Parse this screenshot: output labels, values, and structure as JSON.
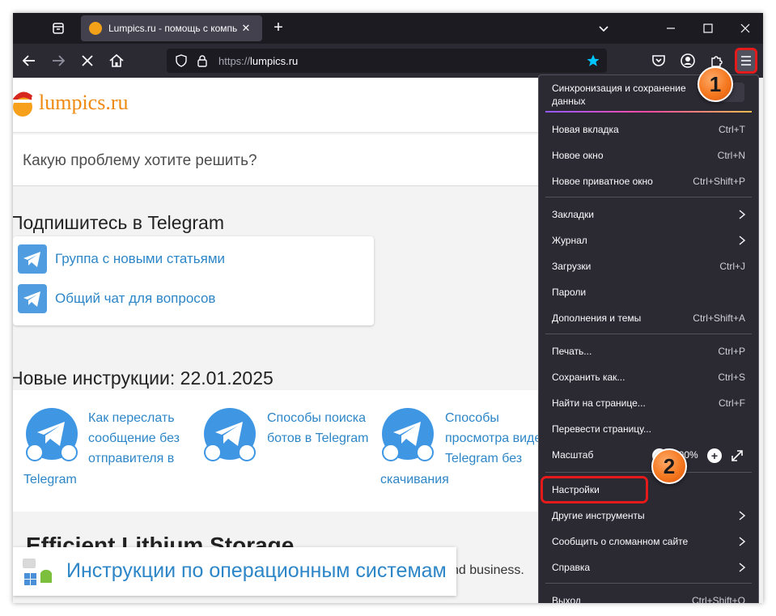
{
  "browser": {
    "tab": {
      "title": "Lumpics.ru - помощь с компь"
    },
    "url": {
      "protocol": "https://",
      "host": "lumpics.ru"
    },
    "icons": {
      "tab_list": "tab-list-icon",
      "close": "close-icon",
      "new_tab": "plus-icon",
      "back": "back-arrow-icon",
      "forward": "forward-arrow-icon",
      "stop": "stop-icon",
      "home": "home-icon",
      "shield": "shield-icon",
      "lock": "lock-icon",
      "bookmark": "star-icon",
      "pocket": "pocket-icon",
      "account": "account-icon",
      "extensions": "puzzle-icon",
      "menu": "hamburger-icon"
    }
  },
  "page": {
    "logo": "lumpics.ru",
    "search_placeholder": "Какую проблему хотите решить?",
    "telegram_heading": "Подпишитесь в Telegram",
    "telegram_links": [
      "Группа с новыми статьями",
      "Общий чат для вопросов"
    ],
    "new_heading": "Новые инструкции: 22.01.2025",
    "articles": [
      {
        "lines": [
          "Как переслать",
          "сообщение без",
          "отправителя в"
        ],
        "tail": "Telegram"
      },
      {
        "lines": [
          "Способы поиска",
          "ботов в Telegram"
        ],
        "tail": ""
      },
      {
        "lines": [
          "Способы",
          "просмотра виде",
          "Telegram без"
        ],
        "tail": "скачивания"
      }
    ],
    "ad_title": "Efficient Lithium Storage",
    "ad_tail": "nd business.",
    "os_banner": "Инструкции по операционным системам"
  },
  "menu": {
    "sync": "Синхронизация и сохранение данных",
    "items": [
      {
        "label": "Новая вкладка",
        "shortcut": "Ctrl+T"
      },
      {
        "label": "Новое окно",
        "shortcut": "Ctrl+N"
      },
      {
        "label": "Новое приватное окно",
        "shortcut": "Ctrl+Shift+P"
      },
      {
        "label": "Закладки",
        "shortcut": ""
      },
      {
        "label": "Журнал",
        "shortcut": ""
      },
      {
        "label": "Загрузки",
        "shortcut": "Ctrl+J"
      },
      {
        "label": "Пароли",
        "shortcut": ""
      },
      {
        "label": "Дополнения и темы",
        "shortcut": "Ctrl+Shift+A"
      },
      {
        "label": "Печать...",
        "shortcut": "Ctrl+P"
      },
      {
        "label": "Сохранить как...",
        "shortcut": "Ctrl+S"
      },
      {
        "label": "Найти на странице...",
        "shortcut": "Ctrl+F"
      },
      {
        "label": "Перевести страницу...",
        "shortcut": ""
      },
      {
        "label": "Масштаб",
        "shortcut": ""
      },
      {
        "label": "Настройки",
        "shortcut": ""
      },
      {
        "label": "Другие инструменты",
        "shortcut": ""
      },
      {
        "label": "Сообщить о сломанном сайте",
        "shortcut": ""
      },
      {
        "label": "Справка",
        "shortcut": ""
      },
      {
        "label": "Выход",
        "shortcut": "Ctrl+Shift+Q"
      }
    ],
    "zoom": {
      "minus": "−",
      "value": "100%",
      "plus": "+"
    }
  },
  "callouts": {
    "first": "1",
    "second": "2"
  },
  "colors": {
    "accent_red": "#e51a1a",
    "callout_orange": "#f5781f",
    "link_blue": "#2d86c7",
    "telegram_blue": "#3f97e4",
    "menu_bg": "#2b2a33"
  }
}
